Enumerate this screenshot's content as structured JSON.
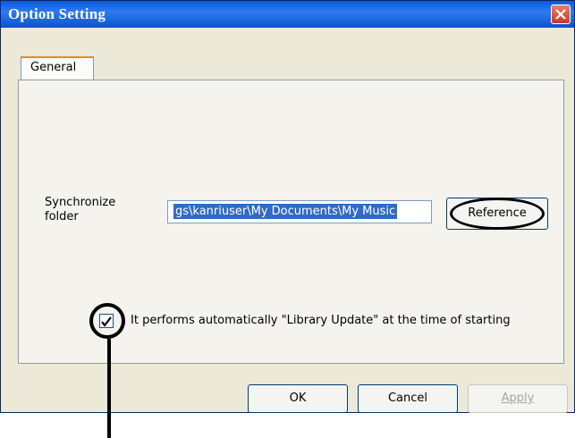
{
  "window": {
    "title": "Option Setting"
  },
  "tabs": [
    {
      "label": "General"
    }
  ],
  "sync": {
    "label": "Synchronize\nfolder",
    "folder_value": "gs\\kanriuser\\My Documents\\My Music",
    "reference_label": "Reference"
  },
  "auto_update": {
    "checked": true,
    "label": "It performs automatically \"Library Update\" at the time of starting"
  },
  "buttons": {
    "ok": "OK",
    "cancel": "Cancel",
    "apply": "Apply"
  },
  "colors": {
    "titlebar": "#0a5ad8",
    "selection": "#316ac5",
    "window_bg": "#ece9d8"
  }
}
